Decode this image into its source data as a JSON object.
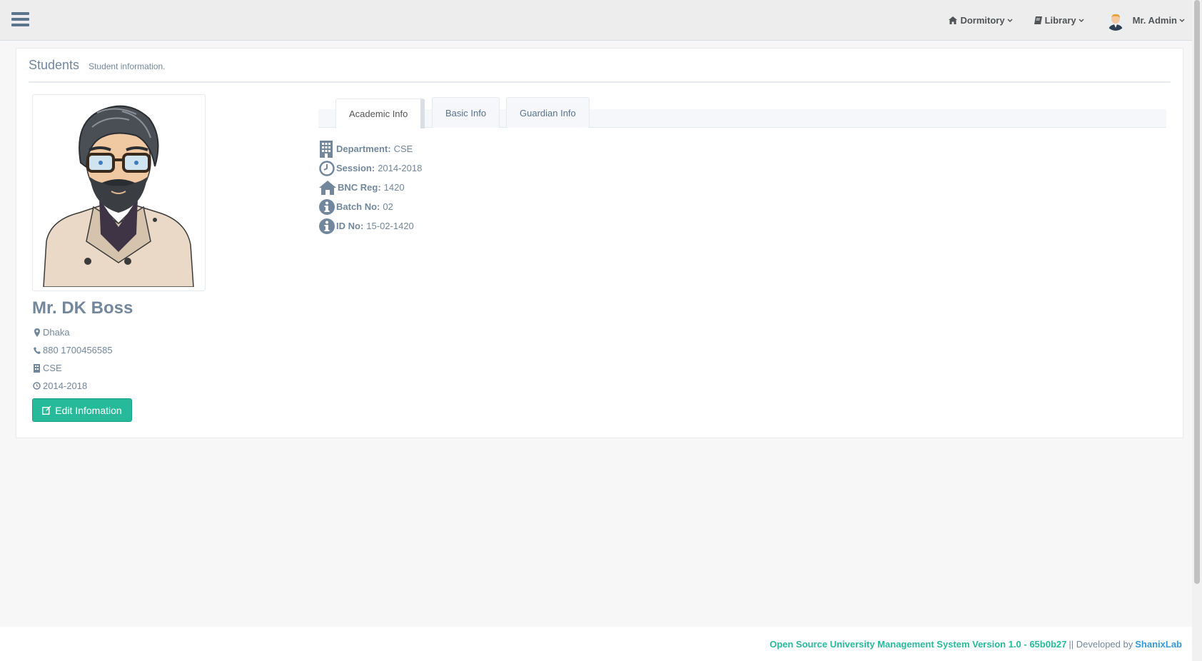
{
  "nav": {
    "dormitory": "Dormitory",
    "library": "Library",
    "user": "Mr. Admin"
  },
  "panel": {
    "title": "Students",
    "subtitle": "Student information."
  },
  "profile": {
    "name": "Mr. DK Boss",
    "location": "Dhaka",
    "phone": "880 1700456585",
    "department": "CSE",
    "session": "2014-2018",
    "edit_label": "Edit Infomation"
  },
  "tabs": [
    {
      "label": "Academic Info"
    },
    {
      "label": "Basic Info"
    },
    {
      "label": "Guardian Info"
    }
  ],
  "academic": [
    {
      "label": "Department:",
      "value": "CSE",
      "icon": "building-icon"
    },
    {
      "label": "Session:",
      "value": "2014-2018",
      "icon": "clock-icon"
    },
    {
      "label": "BNC Reg:",
      "value": "1420",
      "icon": "home-icon"
    },
    {
      "label": "Batch No:",
      "value": "02",
      "icon": "info-icon"
    },
    {
      "label": "ID No:",
      "value": "15-02-1420",
      "icon": "info-icon"
    }
  ],
  "footer": {
    "system": "Open Source University Management System Version 1.0 - 65b0b27",
    "separator": "|| Developed by",
    "developer": "ShanixLab"
  },
  "colors": {
    "accent": "#26b99a",
    "link": "#3498db",
    "text": "#73879c"
  }
}
